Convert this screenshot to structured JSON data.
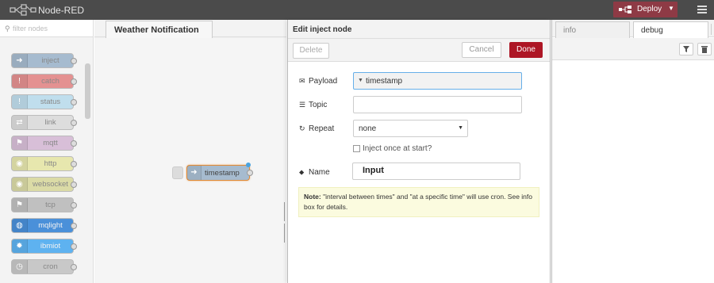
{
  "header": {
    "title": "Node-RED",
    "deploy_label": "Deploy",
    "deploy_color": "#8e3a45",
    "header_color": "#4b4b4b"
  },
  "palette": {
    "search_placeholder": "filter nodes",
    "nodes": [
      {
        "label": "inject",
        "color": "#a6bbcf",
        "icon": "arrow-icon"
      },
      {
        "label": "catch",
        "color": "#e49191",
        "icon": "exclamation-icon"
      },
      {
        "label": "status",
        "color": "#c0deed",
        "icon": "exclamation-icon"
      },
      {
        "label": "link",
        "color": "#dddddd",
        "icon": "link-icon"
      },
      {
        "label": "mqtt",
        "color": "#d8bfd8",
        "icon": "bridge-icon"
      },
      {
        "label": "http",
        "color": "#e7e7ae",
        "icon": "globe-icon"
      },
      {
        "label": "websocket",
        "color": "#dbdba6",
        "icon": "globe-icon"
      },
      {
        "label": "tcp",
        "color": "#c0c0c0",
        "icon": "bridge-icon"
      },
      {
        "label": "mqlight",
        "color": "#4a90d9",
        "icon": "mqlight-icon"
      },
      {
        "label": "ibmiot",
        "color": "#5eb2f0",
        "icon": "gear-icon"
      },
      {
        "label": "cron",
        "color": "#c8c8c8",
        "icon": "clock-icon"
      }
    ]
  },
  "workspace": {
    "flow_tab": "Weather Notification",
    "canvas_node_label": "timestamp"
  },
  "editor": {
    "title": "Edit inject node",
    "delete_label": "Delete",
    "cancel_label": "Cancel",
    "done_label": "Done",
    "payload_label": "Payload",
    "payload_value": "timestamp",
    "topic_label": "Topic",
    "topic_value": "",
    "repeat_label": "Repeat",
    "repeat_value": "none",
    "once_label": "Inject once at start?",
    "name_label": "Name",
    "name_value": "Input",
    "note_bold": "Note:",
    "note_text": " \"interval between times\" and \"at a specific time\" will use cron. See info box for details.",
    "done_color": "#ad1625"
  },
  "sidebar": {
    "tab_info": "info",
    "tab_debug": "debug"
  }
}
